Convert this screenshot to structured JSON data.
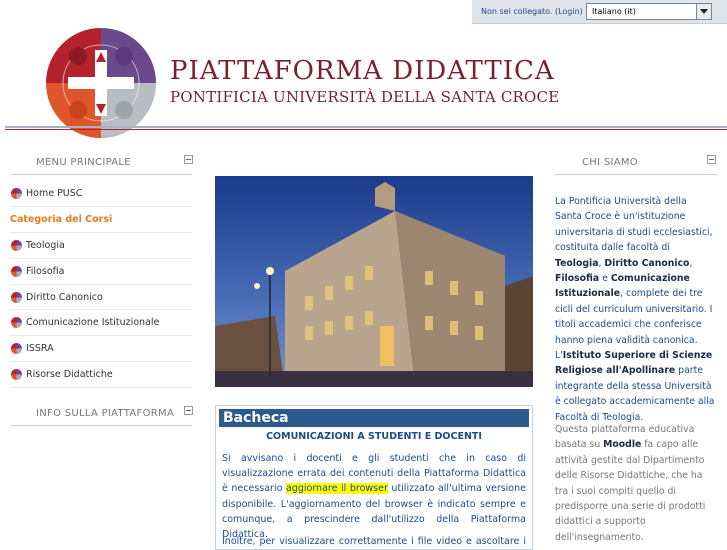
{
  "topbar": {
    "login_status": "Non sei collegato.",
    "login_link": "(Login)",
    "language": "Italiano (it)"
  },
  "header": {
    "title": "PIATTAFORMA DIDATTICA",
    "subtitle": "PONTIFICIA UNIVERSITÀ DELLA SANTA CROCE",
    "logo_icon": "pusc-puzzle-logo"
  },
  "menu_principale": {
    "title": "MENU PRINCIPALE",
    "items": [
      {
        "label": "Home PUSC",
        "icon": "puzzle-icon"
      },
      {
        "label": "Categoria dei Corsi",
        "icon": ""
      },
      {
        "label": "Teologia",
        "icon": "puzzle-icon"
      },
      {
        "label": "Filosofia",
        "icon": "puzzle-icon"
      },
      {
        "label": "Diritto Canonico",
        "icon": "puzzle-icon"
      },
      {
        "label": "Comunicazione Istituzionale",
        "icon": "puzzle-icon"
      },
      {
        "label": "ISSRA",
        "icon": "puzzle-icon"
      },
      {
        "label": "Risorse Didattiche",
        "icon": "puzzle-icon"
      }
    ]
  },
  "info_block": {
    "title": "INFO SULLA PIATTAFORMA"
  },
  "bacheca": {
    "title": "Bacheca",
    "subtitle": "COMUNICAZIONI A STUDENTI E DOCENTI",
    "p1_a": "Si avvisano i docenti e gli studenti che in caso di visualizzazione errata dei contenuti della Piattaforma Didattica è necessario ",
    "p1_hl": "aggiornare il browser",
    "p1_b": " utilizzato all'ultima versione disponibile. L'aggiornamento del browser è indicato sempre e comunque, a prescindere dall'utilizzo della Piattaforma Didattica.",
    "p2": "Inoltre, per visualizzare correttamente i file video e ascoltare i file audio"
  },
  "chi_siamo": {
    "title": "CHI SIAMO",
    "t1": "La Pontificia Università della Santa Croce è un'istituzione universitaria di studi ecclesiastici, costituita dalle facoltà di ",
    "b1": "Teologia",
    "t2": ", ",
    "b2": "Diritto Canonico",
    "t3": ", ",
    "b3": "Filosofia",
    "t4": " e ",
    "b4": "Comunicazione Istituzionale",
    "t5": ", complete dei tre cicli del curriculum universitario. I titoli accademici che conferisce hanno piena validità canonica. L'",
    "b5": "Istituto Superiore di Scienze Religiose all'Apollinare",
    "t6": " parte integrante della stessa Università è collegato accademicamente alla Facoltà di Teologia.",
    "m1": "Questa piattaforma educativa basata su ",
    "mb": "Moodle",
    "m2": " fa capo alle attività gestite dal Dipartimento delle Risorse Didattiche, che ha tra i suoi compiti quello di predisporre una serie di prodotti didattici a supporto dell'insegnamento."
  },
  "colors": {
    "title_red": "#7a1f2b",
    "link_blue": "#1a4b8c",
    "category_orange": "#e07b1a",
    "bacheca_header": "#2d5a8e",
    "highlight": "#ffff00"
  }
}
